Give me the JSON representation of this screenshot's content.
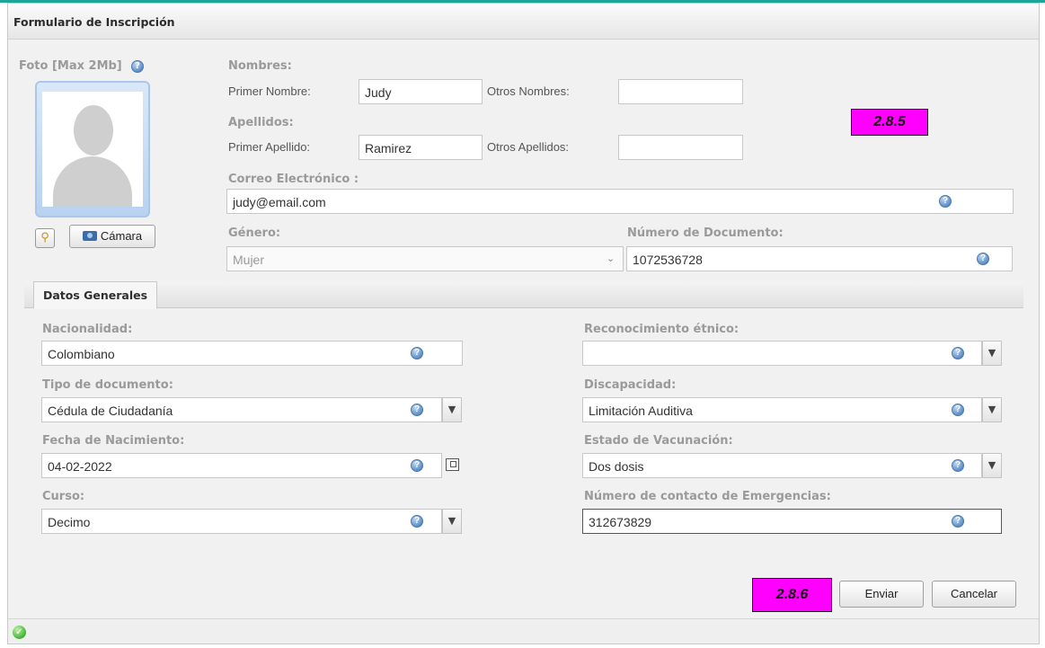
{
  "window": {
    "title": "Formulario de Inscripción"
  },
  "photo": {
    "label": "Foto [Max 2Mb]",
    "camera_button": "Cámara"
  },
  "names": {
    "section_label": "Nombres:",
    "first_name_label": "Primer Nombre:",
    "first_name_value": "Judy",
    "other_names_label": "Otros Nombres:",
    "other_names_value": ""
  },
  "surnames": {
    "section_label": "Apellidos:",
    "first_surname_label": "Primer Apellido:",
    "first_surname_value": "Ramirez",
    "other_surnames_label": "Otros Apellidos:",
    "other_surnames_value": ""
  },
  "email": {
    "label": "Correo Electrónico :",
    "value": "judy@email.com"
  },
  "gender": {
    "label": "Género:",
    "value": "Mujer"
  },
  "document_number": {
    "label": "Número de Documento:",
    "value": "1072536728"
  },
  "tabs": [
    {
      "label": "Datos Generales"
    }
  ],
  "general": {
    "nationality": {
      "label": "Nacionalidad:",
      "value": "Colombiano"
    },
    "document_type": {
      "label": "Tipo de documento:",
      "value": "Cédula de Ciudadanía"
    },
    "birth_date": {
      "label": "Fecha de Nacimiento:",
      "value": "04-02-2022"
    },
    "course": {
      "label": "Curso:",
      "value": "Decimo"
    },
    "ethnic": {
      "label": "Reconocimiento étnico:",
      "value": ""
    },
    "disability": {
      "label": "Discapacidad:",
      "value": "Limitación Auditiva"
    },
    "vaccination": {
      "label": "Estado de Vacunación:",
      "value": "Dos dosis"
    },
    "emergency_contact": {
      "label": "Número de contacto de Emergencias:",
      "value": "312673829"
    }
  },
  "actions": {
    "submit": "Enviar",
    "cancel": "Cancelar"
  },
  "annotations": {
    "marker_top": "2.8.5",
    "marker_bottom": "2.8.6"
  },
  "colors": {
    "accent": "#1aa79a",
    "marker": "#ff00ff",
    "help_icon": "#5f8fc6"
  },
  "icons": [
    "help-icon",
    "wrench-icon",
    "camera-icon",
    "chevron-down-icon",
    "calendar-icon",
    "check-circle-icon"
  ]
}
